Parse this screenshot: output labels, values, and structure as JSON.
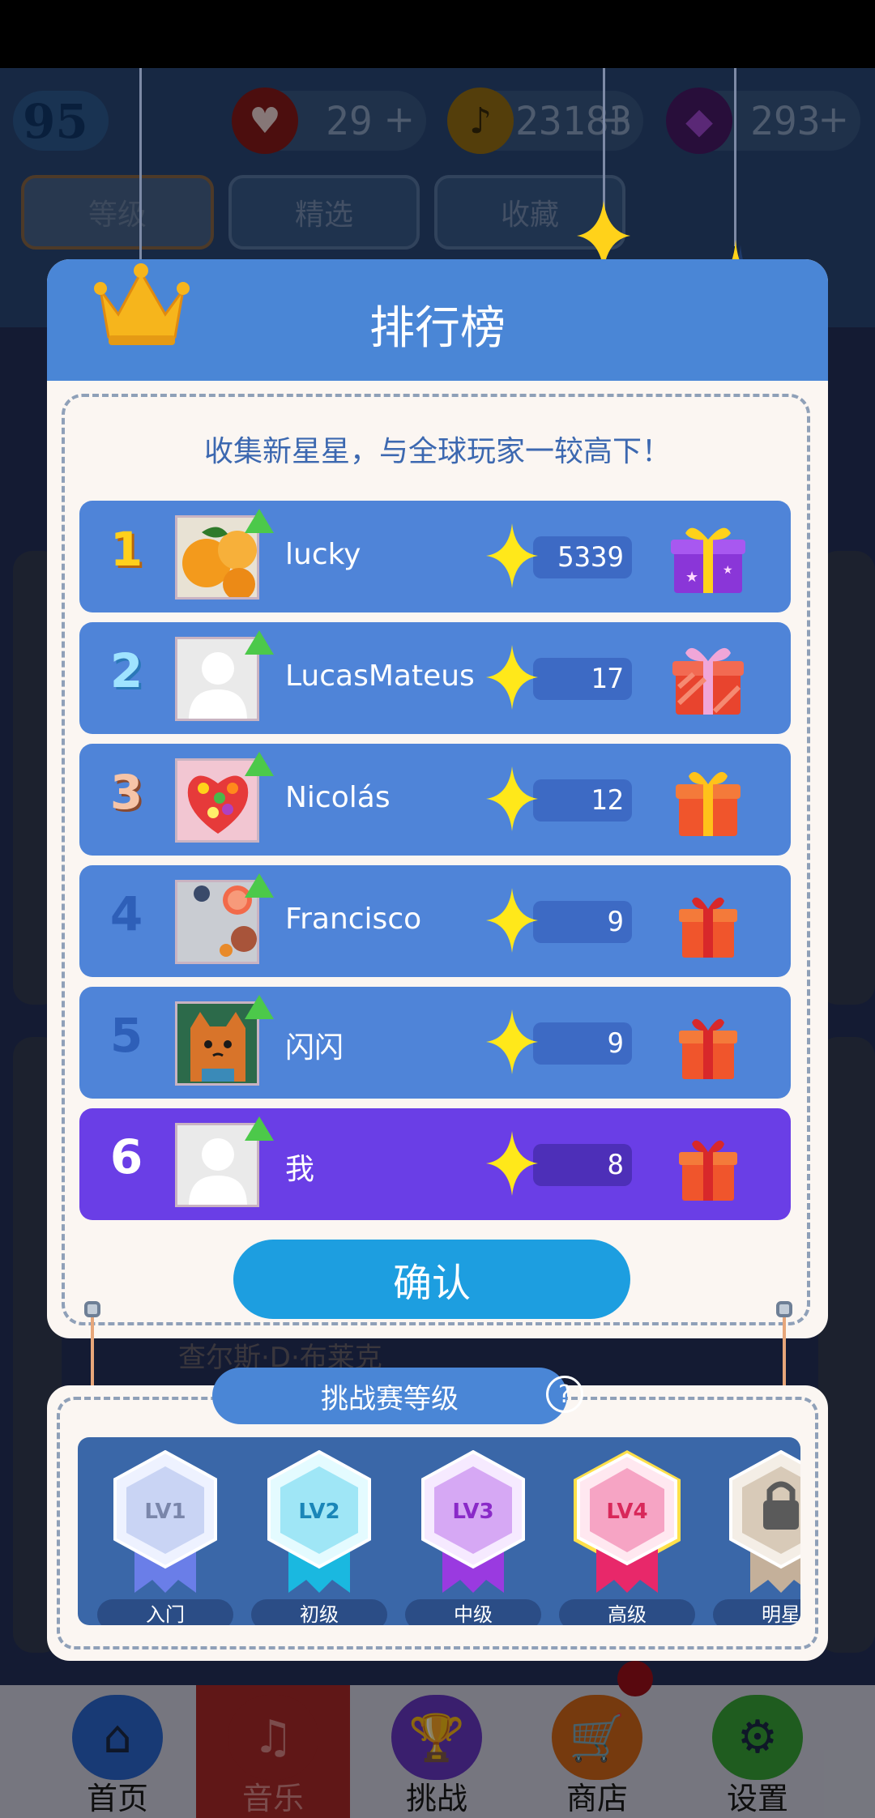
{
  "background": {
    "level": "95",
    "lives": "29",
    "notes": "23183",
    "gems": "293",
    "plus": "+",
    "tabs": [
      "等级",
      "精选",
      "收藏"
    ],
    "song_text": "查尔斯·D·布莱克"
  },
  "leaderboard": {
    "title": "排行榜",
    "subtitle": "收集新星星，与全球玩家一较高下！",
    "rows": [
      {
        "rank": "1",
        "name": "lucky",
        "score": "5339",
        "avatar": "oranges"
      },
      {
        "rank": "2",
        "name": "LucasMateus",
        "score": "17",
        "avatar": "default-user"
      },
      {
        "rank": "3",
        "name": "Nicolás",
        "score": "12",
        "avatar": "candy-heart"
      },
      {
        "rank": "4",
        "name": "Francisco",
        "score": "9",
        "avatar": "grapefruit"
      },
      {
        "rank": "5",
        "name": "闪闪",
        "score": "9",
        "avatar": "cartoon-cat"
      },
      {
        "rank": "6",
        "name": "我",
        "score": "8",
        "avatar": "default-user"
      }
    ],
    "confirm_label": "确认"
  },
  "challenge": {
    "title": "挑战赛等级",
    "help": "?",
    "levels": [
      {
        "code": "LV1",
        "name": "入门",
        "color": "#c9d4f4"
      },
      {
        "code": "LV2",
        "name": "初级",
        "color": "#9fe6f6"
      },
      {
        "code": "LV3",
        "name": "中级",
        "color": "#d6a8f4"
      },
      {
        "code": "LV4",
        "name": "高级",
        "color": "#f6a4c4"
      },
      {
        "code": "",
        "name": "明星",
        "color": "#d8cab8"
      }
    ]
  },
  "nav": {
    "items": [
      "首页",
      "音乐",
      "挑战",
      "商店",
      "设置"
    ]
  },
  "colors": {
    "header_blue": "#4a86d6",
    "row_blue": "#4f84d8",
    "row_me": "#6a3ee6",
    "star_yellow": "#ffe81a",
    "confirm_blue": "#1d9ee0"
  }
}
